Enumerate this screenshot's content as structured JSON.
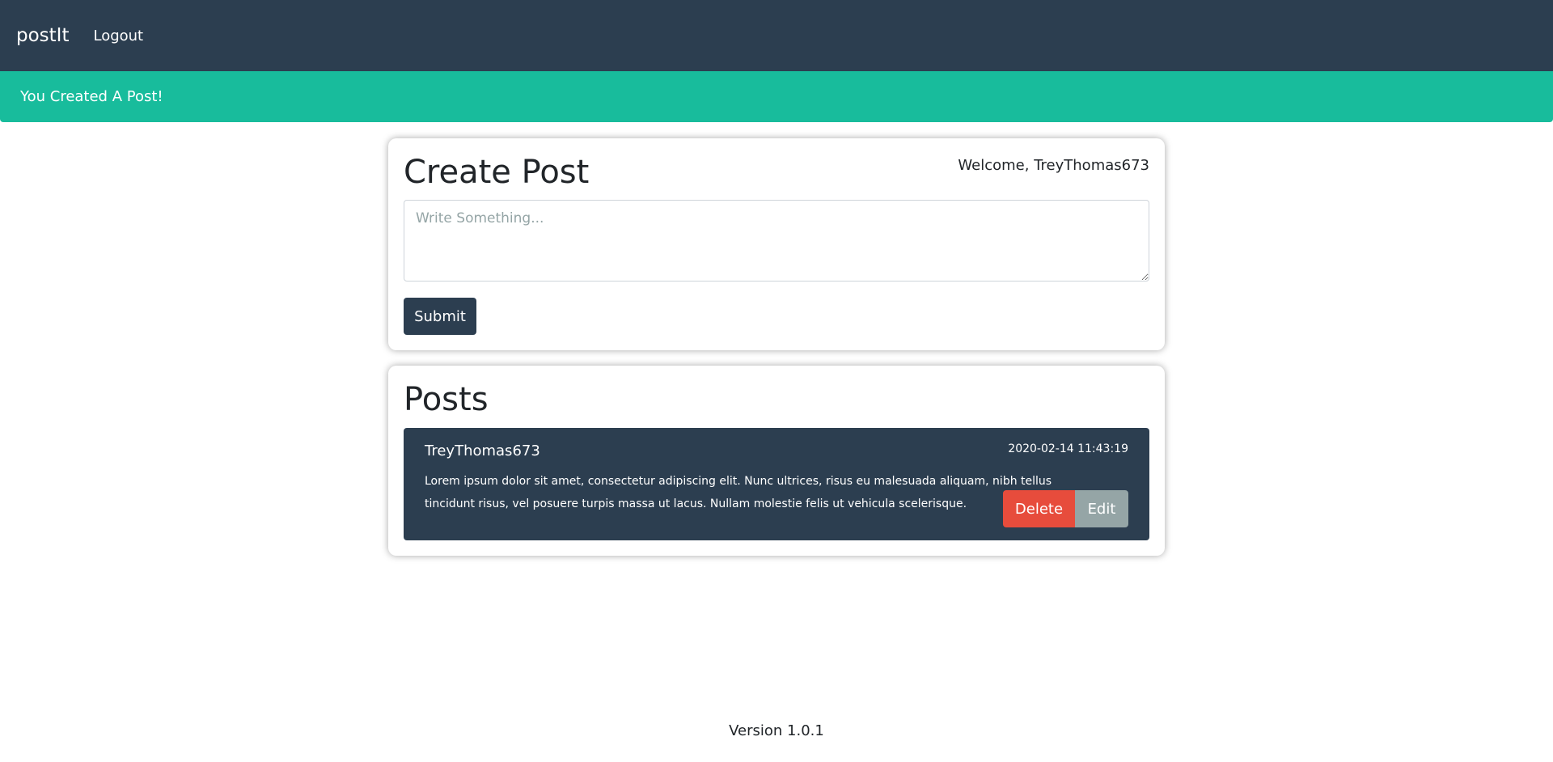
{
  "navbar": {
    "brand": "postIt",
    "logout_label": "Logout"
  },
  "alert": {
    "message": "You Created A Post!"
  },
  "create_post": {
    "title": "Create Post",
    "welcome": "Welcome, TreyThomas673",
    "placeholder": "Write Something...",
    "value": "",
    "submit_label": "Submit"
  },
  "posts_section": {
    "title": "Posts",
    "items": [
      {
        "author": "TreyThomas673",
        "date": "2020-02-14 11:43:19",
        "body": "Lorem ipsum dolor sit amet, consectetur adipiscing elit. Nunc ultrices, risus eu malesuada aliquam, nibh tellus tincidunt risus, vel posuere turpis massa ut lacus. Nullam molestie felis ut vehicula scelerisque.",
        "delete_label": "Delete",
        "edit_label": "Edit"
      }
    ]
  },
  "footer": {
    "version": "Version 1.0.1"
  },
  "colors": {
    "navbar": "#2c3e50",
    "alert_success": "#18bc9c",
    "delete": "#e74c3c",
    "edit": "#95a5a6"
  }
}
